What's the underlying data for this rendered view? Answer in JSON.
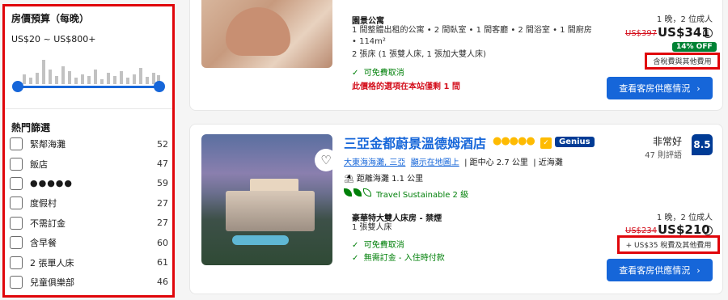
{
  "sidebar": {
    "budget_title": "房價預算（每晚）",
    "budget_range": "US$20 ~ US$800+",
    "popular_title": "熱門篩選",
    "filters": [
      {
        "label": "緊鄰海灘",
        "count": "52"
      },
      {
        "label": "飯店",
        "count": "47"
      },
      {
        "label": "●●●●●",
        "count": "59"
      },
      {
        "label": "度假村",
        "count": "27"
      },
      {
        "label": "不需訂金",
        "count": "27"
      },
      {
        "label": "含早餐",
        "count": "60"
      },
      {
        "label": "2 張單人床",
        "count": "61"
      },
      {
        "label": "兒童俱樂部",
        "count": "46"
      }
    ]
  },
  "card1": {
    "room_title": "園景公寓",
    "room_desc1": "1 間整體出租的公寓 • 2 間臥室 • 1 間客廳 • 2 間浴室 • 1 間廚房",
    "room_desc2": "• 114m²",
    "beds": "2 張床 (1 張雙人床, 1 張加大雙人床)",
    "free_cancel": "可免費取消",
    "only_left": "此價格的選項在本站僅剩 1 間",
    "meta": "1 晚，2 位成人",
    "old_price": "US$397",
    "price": "US$341",
    "discount": "14% OFF",
    "tax_note": "含稅費與其他費用",
    "cta": "查看客房供應情況"
  },
  "card2": {
    "hotel_name": "三亞金都蔚景溫德姆酒店",
    "stars": "●●●●●",
    "genius": "Genius",
    "score_word": "非常好",
    "reviews": "47 則評語",
    "score": "8.5",
    "area_link": "大東海海灘, 三亞",
    "map_link": "顯示在地圖上",
    "distance": "距中心 2.7 公里",
    "near_beach": "近海灘",
    "beach_distance": "距離海灘 1.1 公里",
    "sustainable": "Travel Sustainable 2 級",
    "room_title": "豪華特大雙人床房 - 禁煙",
    "beds": "1 張雙人床",
    "free_cancel": "可免費取消",
    "no_deposit": "無需訂金 - 入住時付款",
    "meta": "1 晚，2 位成人",
    "old_price": "US$234",
    "price": "US$210",
    "tax_note": "+ US$35 稅費及其他費用",
    "cta": "查看客房供應情況"
  },
  "icons": {
    "chevron": "›",
    "check": "✓",
    "heart": "♡",
    "info": "i",
    "thumb": "👍"
  }
}
